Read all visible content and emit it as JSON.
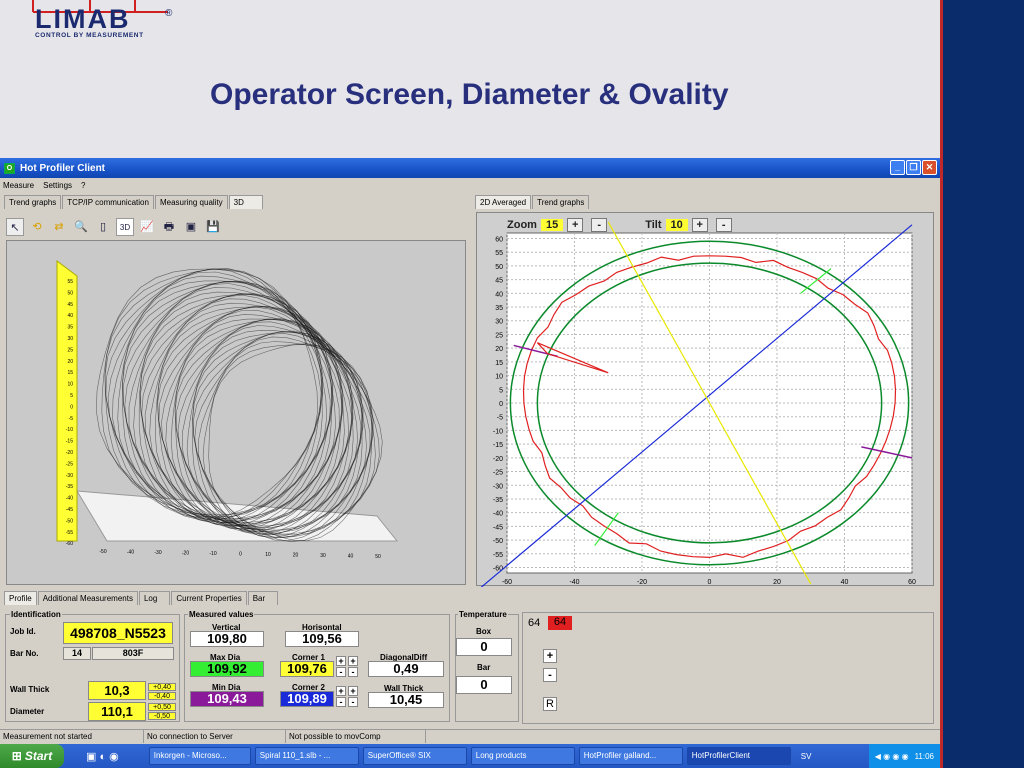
{
  "slide": {
    "title": "Operator Screen, Diameter & Ovality",
    "logo": "LIMAB",
    "logo_sub": "CONTROL BY MEASUREMENT",
    "reg": "®"
  },
  "window": {
    "title": "Hot Profiler Client",
    "menu": [
      "Measure",
      "Settings",
      "?"
    ]
  },
  "left_tabs": [
    "Trend graphs",
    "TCP/IP communication",
    "Measuring quality",
    "3D"
  ],
  "right_tabs": [
    "2D Averaged",
    "Trend graphs"
  ],
  "zoom": {
    "label": "Zoom",
    "value": "15",
    "plus": "+",
    "minus": "-"
  },
  "tilt": {
    "label": "Tilt",
    "value": "10",
    "plus": "+",
    "minus": "-"
  },
  "plot2d": {
    "x_ticks": [
      "-60",
      "-40",
      "-20",
      "0",
      "20",
      "40",
      "60"
    ],
    "y_ticks": [
      "60",
      "55",
      "50",
      "45",
      "40",
      "35",
      "30",
      "25",
      "20",
      "15",
      "10",
      "5",
      "0",
      "-5",
      "-10",
      "-15",
      "-20",
      "-25",
      "-30",
      "-35",
      "-40",
      "-45",
      "-50",
      "-55",
      "-60"
    ]
  },
  "plot3d": {
    "z_ticks": [
      "55",
      "50",
      "45",
      "40",
      "35",
      "30",
      "25",
      "20",
      "15",
      "10",
      "5",
      "0",
      "-5",
      "-10",
      "-15",
      "-20",
      "-25",
      "-30",
      "-35",
      "-40",
      "-45",
      "-50",
      "-55",
      "-60"
    ],
    "x_ticks": [
      "-50",
      "-40",
      "-30",
      "-20",
      "-10",
      "0",
      "10",
      "20",
      "30",
      "40",
      "50"
    ]
  },
  "bottom_tabs": [
    "Profile",
    "Additional Measurements",
    "Log",
    "Current Properties",
    "Bar"
  ],
  "ident": {
    "group": "Identification",
    "job_label": "Job Id.",
    "job": "498708_N5523",
    "bar_label": "Bar No.",
    "bar_a": "14",
    "bar_b": "803F",
    "wall_label": "Wall Thick",
    "wall": "10,3",
    "wall_tol_plus": "+0,40",
    "wall_tol_minus": "-0,40",
    "dia_label": "Diameter",
    "dia": "110,1",
    "dia_tol_plus": "+0,50",
    "dia_tol_minus": "-0,50"
  },
  "measured": {
    "group": "Measured values",
    "vertical_label": "Vertical",
    "vertical": "109,80",
    "horizontal_label": "Horisontal",
    "horizontal": "109,56",
    "maxdia_label": "Max Dia",
    "maxdia": "109,92",
    "corner1_label": "Corner 1",
    "corner1": "109,76",
    "diag_label": "DiagonalDiff",
    "diag": "0,49",
    "mindia_label": "Min Dia",
    "mindia": "109,43",
    "corner2_label": "Corner 2",
    "corner2": "109,89",
    "wall_label": "Wall Thick",
    "wall": "10,45"
  },
  "temperature": {
    "group": "Temperature",
    "box_label": "Box",
    "box": "0",
    "bar_label": "Bar",
    "bar": "0"
  },
  "side": {
    "val_a": "64",
    "val_b": "64",
    "plus": "+",
    "minus": "-",
    "r": "R"
  },
  "status": [
    "Measurement not started",
    "No connection to Server",
    "Not possible to movComp"
  ],
  "taskbar": {
    "start": "Start",
    "tasks": [
      "Inkorgen - Microso...",
      "Spiral 110_1.slb - ...",
      "SuperOffice® SIX",
      "Long products",
      "HotProfiler galland...",
      "HotProfilerClient"
    ],
    "lang": "SV",
    "clock": "11:06"
  },
  "colors": {
    "accent": "#28307e",
    "titlebar": "#1853c8",
    "yellow": "#ffff33",
    "green": "#33ee33",
    "purple": "#8a1a9a",
    "blue": "#1a2ad8",
    "red": "#e02020"
  }
}
